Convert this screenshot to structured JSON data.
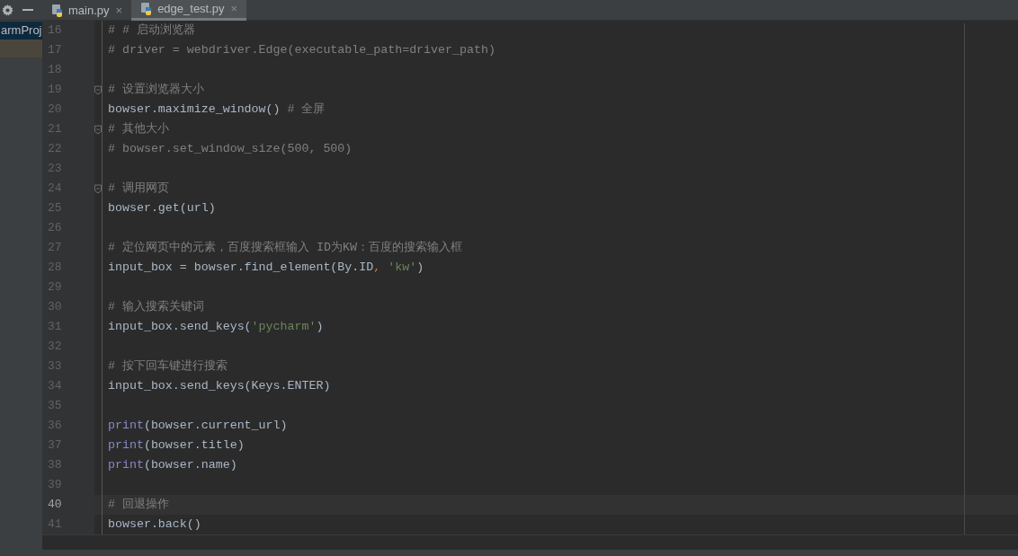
{
  "project_panel": {
    "items": [
      {
        "label": "armProj",
        "selected": true
      },
      {
        "selected": false
      }
    ]
  },
  "tabs": [
    {
      "label": "main.py",
      "close": "×",
      "selected": false
    },
    {
      "label": "edge_test.py",
      "close": "×",
      "selected": true
    }
  ],
  "lines": [
    {
      "number": "16",
      "fold": false,
      "current": false,
      "tokens": [
        {
          "kind": "comment",
          "text": "# # 启动浏览器"
        }
      ]
    },
    {
      "number": "17",
      "fold": false,
      "current": false,
      "tokens": [
        {
          "kind": "comment",
          "text": "# driver = webdriver.Edge(executable_path=driver_path)"
        }
      ]
    },
    {
      "number": "18",
      "fold": false,
      "current": false
    },
    {
      "number": "19",
      "fold": true,
      "current": false,
      "tokens": [
        {
          "kind": "comment",
          "text": "# 设置浏览器大小"
        }
      ]
    },
    {
      "number": "20",
      "fold": false,
      "current": false,
      "tokens": [
        {
          "kind": "plain",
          "text": "bowser.maximize_window() "
        },
        {
          "kind": "comment",
          "text": "# 全屏"
        }
      ]
    },
    {
      "number": "21",
      "fold": true,
      "current": false,
      "tokens": [
        {
          "kind": "comment",
          "text": "# 其他大小"
        }
      ]
    },
    {
      "number": "22",
      "fold": false,
      "current": false,
      "tokens": [
        {
          "kind": "comment",
          "text": "# bowser.set_window_size(500, 500)"
        }
      ]
    },
    {
      "number": "23",
      "fold": false,
      "current": false
    },
    {
      "number": "24",
      "fold": true,
      "current": false,
      "tokens": [
        {
          "kind": "comment",
          "text": "# 调用网页"
        }
      ]
    },
    {
      "number": "25",
      "fold": false,
      "current": false,
      "tokens": [
        {
          "kind": "plain",
          "text": "bowser.get(url)"
        }
      ]
    },
    {
      "number": "26",
      "fold": false,
      "current": false
    },
    {
      "number": "27",
      "fold": false,
      "current": false,
      "tokens": [
        {
          "kind": "comment",
          "text": "# 定位网页中的元素，百度搜索框输入 ID为KW：百度的搜索输入框"
        }
      ]
    },
    {
      "number": "28",
      "fold": false,
      "current": false,
      "tokens": [
        {
          "kind": "plain",
          "text": "input_box = bowser.find_element(By.ID"
        },
        {
          "kind": "punct",
          "text": ", "
        },
        {
          "kind": "string",
          "text": "'kw'"
        },
        {
          "kind": "plain",
          "text": ")"
        }
      ]
    },
    {
      "number": "29",
      "fold": false,
      "current": false
    },
    {
      "number": "30",
      "fold": false,
      "current": false,
      "tokens": [
        {
          "kind": "comment",
          "text": "# 输入搜索关键词"
        }
      ]
    },
    {
      "number": "31",
      "fold": false,
      "current": false,
      "tokens": [
        {
          "kind": "plain",
          "text": "input_box.send_keys("
        },
        {
          "kind": "string",
          "text": "'pycharm'"
        },
        {
          "kind": "plain",
          "text": ")"
        }
      ]
    },
    {
      "number": "32",
      "fold": false,
      "current": false
    },
    {
      "number": "33",
      "fold": false,
      "current": false,
      "tokens": [
        {
          "kind": "comment",
          "text": "# 按下回车键进行搜索"
        }
      ]
    },
    {
      "number": "34",
      "fold": false,
      "current": false,
      "tokens": [
        {
          "kind": "plain",
          "text": "input_box.send_keys(Keys.ENTER)"
        }
      ]
    },
    {
      "number": "35",
      "fold": false,
      "current": false
    },
    {
      "number": "36",
      "fold": false,
      "current": false,
      "tokens": [
        {
          "kind": "builtin",
          "text": "print"
        },
        {
          "kind": "plain",
          "text": "(bowser.current_url)"
        }
      ]
    },
    {
      "number": "37",
      "fold": false,
      "current": false,
      "tokens": [
        {
          "kind": "builtin",
          "text": "print"
        },
        {
          "kind": "plain",
          "text": "(bowser.title)"
        }
      ]
    },
    {
      "number": "38",
      "fold": false,
      "current": false,
      "tokens": [
        {
          "kind": "builtin",
          "text": "print"
        },
        {
          "kind": "plain",
          "text": "(bowser.name)"
        }
      ]
    },
    {
      "number": "39",
      "fold": false,
      "current": false
    },
    {
      "number": "40",
      "fold": false,
      "current": true,
      "tokens": [
        {
          "kind": "comment",
          "text": "# 回退操作"
        }
      ]
    },
    {
      "number": "41",
      "fold": false,
      "current": false,
      "tokens": [
        {
          "kind": "plain",
          "text": "bowser.back()"
        }
      ]
    }
  ]
}
